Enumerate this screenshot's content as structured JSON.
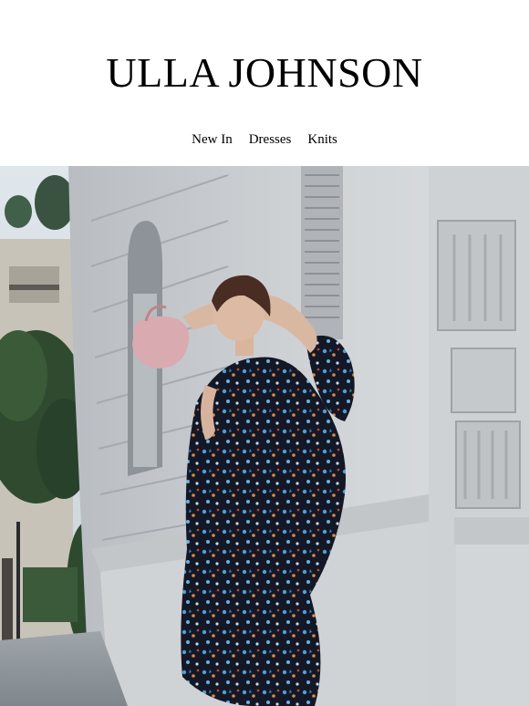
{
  "brand": {
    "name": "ULLA JOHNSON"
  },
  "nav": {
    "items": [
      {
        "label": "New In"
      },
      {
        "label": "Dresses"
      },
      {
        "label": "Knits"
      }
    ]
  },
  "hero": {
    "image": "fashion-photo"
  },
  "colors": {
    "background": "#ffffff",
    "text": "#000000"
  }
}
